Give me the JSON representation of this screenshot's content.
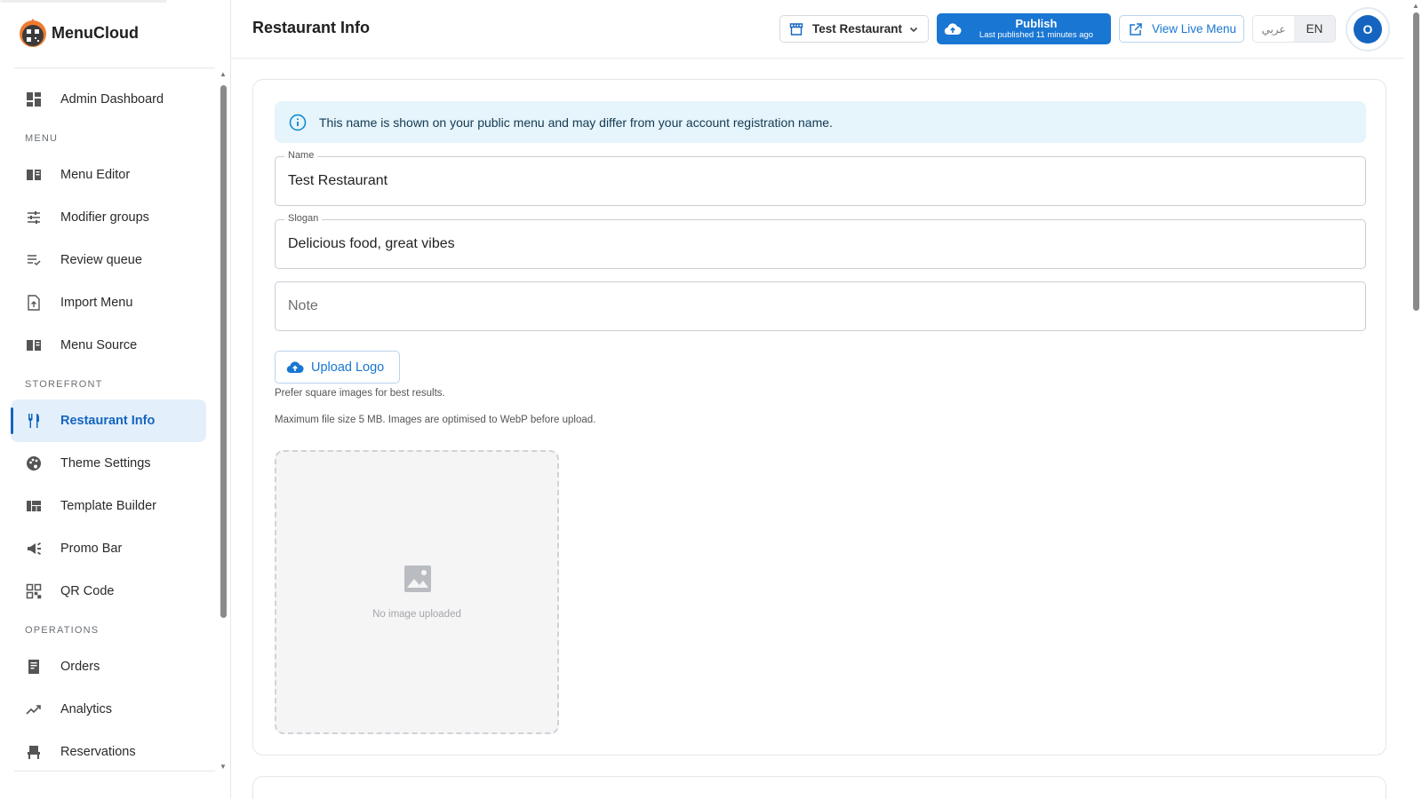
{
  "brand": {
    "name": "MenuCloud"
  },
  "sidebar": {
    "top_item": {
      "label": "Admin Dashboard",
      "icon": "dashboard-icon"
    },
    "sections": [
      {
        "title": "MENU",
        "items": [
          {
            "label": "Menu Editor",
            "icon": "menu-book-icon"
          },
          {
            "label": "Modifier groups",
            "icon": "tune-icon"
          },
          {
            "label": "Review queue",
            "icon": "playlist-check-icon"
          },
          {
            "label": "Import Menu",
            "icon": "file-upload-icon"
          },
          {
            "label": "Menu Source",
            "icon": "menu-book-icon"
          }
        ]
      },
      {
        "title": "STOREFRONT",
        "items": [
          {
            "label": "Restaurant Info",
            "icon": "restaurant-icon",
            "active": true
          },
          {
            "label": "Theme Settings",
            "icon": "palette-icon"
          },
          {
            "label": "Template Builder",
            "icon": "view-quilt-icon"
          },
          {
            "label": "Promo Bar",
            "icon": "campaign-icon"
          },
          {
            "label": "QR Code",
            "icon": "qr-code-icon"
          }
        ]
      },
      {
        "title": "OPERATIONS",
        "items": [
          {
            "label": "Orders",
            "icon": "receipt-icon"
          },
          {
            "label": "Analytics",
            "icon": "trending-up-icon"
          },
          {
            "label": "Reservations",
            "icon": "event-seat-icon"
          }
        ]
      }
    ]
  },
  "header": {
    "title": "Restaurant Info",
    "restaurant_selector": "Test Restaurant",
    "publish": {
      "label": "Publish",
      "subtitle": "Last published 11 minutes ago"
    },
    "view_live": "View Live Menu",
    "languages": [
      "عربي",
      "EN"
    ],
    "active_language": "EN",
    "avatar_initial": "O"
  },
  "form": {
    "alert": "This name is shown on your public menu and may differ from your account registration name.",
    "name": {
      "label": "Name",
      "value": "Test Restaurant"
    },
    "slogan": {
      "label": "Slogan",
      "value": "Delicious food, great vibes"
    },
    "note": {
      "placeholder": "Note"
    },
    "upload_logo": "Upload Logo",
    "hint_1": "Prefer square images for best results.",
    "hint_2": "Maximum file size 5 MB. Images are optimised to WebP before upload.",
    "logo_empty": "No image uploaded"
  },
  "colors": {
    "primary": "#1976d2",
    "active_bg": "#e3f0fb",
    "alert_bg": "#e6f4fb"
  }
}
